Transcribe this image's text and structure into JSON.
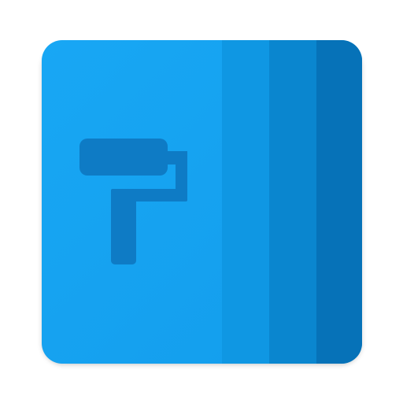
{
  "app_icon": {
    "name": "paint-roller-app-icon",
    "colors": {
      "main_panel": "#18A7F4",
      "main_panel_gradient_end": "#139DEC",
      "stripe_1": "#0F97E3",
      "stripe_2": "#0A86CF",
      "stripe_3": "#0672B8",
      "roller_glyph": "#0E7BC5",
      "background": "#FFFFFF"
    },
    "glyph": "paint-roller-icon"
  }
}
